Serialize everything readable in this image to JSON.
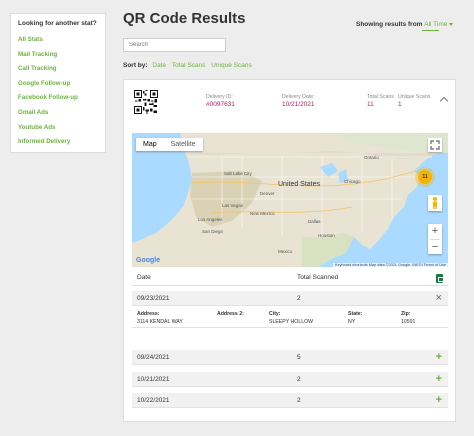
{
  "sidebar": {
    "title": "Looking for another stat?",
    "items": [
      "All Stats",
      "Mail Tracking",
      "Call Tracking",
      "Google Follow-up",
      "Facebook Follow-up",
      "Gmail Ads",
      "Youtube Ads",
      "Informed Delivery"
    ]
  },
  "header": {
    "title": "QR Code Results",
    "showing_label": "Showing results from",
    "range_value": "All Time"
  },
  "search": {
    "placeholder": "Search"
  },
  "sort": {
    "label": "Sort by:",
    "options": [
      "Date",
      "Total Scans",
      "Unique Scans"
    ]
  },
  "card": {
    "delivery_id_label": "Delivery ID:",
    "delivery_id": "#0097631",
    "delivery_date_label": "Delivery Date:",
    "delivery_date": "10/21/2021",
    "total_scans_label": "Total Scans",
    "total_scans": "11",
    "unique_scans_label": "Unique Scans",
    "unique_scans": "1"
  },
  "map": {
    "tabs": [
      "Map",
      "Satellite"
    ],
    "country_label": "United States",
    "marker_count": "11",
    "google": "Google",
    "attribution": "Keyboard shortcuts   Map data ©2021 Google, INEGI   Terms of Use",
    "place_labels": [
      "Salt Lake City",
      "Las Vegas",
      "Los Angeles",
      "San Diego",
      "Denver",
      "Dallas",
      "Houston",
      "Chicago",
      "New Mexico",
      "Mexico",
      "Ontario"
    ]
  },
  "table": {
    "headers": {
      "date": "Date",
      "total": "Total Scanned"
    },
    "rows": [
      {
        "date": "09/23/2021",
        "total": "2",
        "expanded": true
      },
      {
        "date": "09/24/2021",
        "total": "5",
        "expanded": false
      },
      {
        "date": "10/21/2021",
        "total": "2",
        "expanded": false
      },
      {
        "date": "10/22/2021",
        "total": "2",
        "expanded": false
      }
    ],
    "detail": {
      "address_label": "Address:",
      "address": "3114 KENDAL WAY",
      "address2_label": "Address 2:",
      "address2": "",
      "city_label": "City:",
      "city": "SLEEPY HOLLOW",
      "state_label": "State:",
      "state": "NY",
      "zip_label": "Zip:",
      "zip": "10591"
    },
    "actions": {
      "close": "×",
      "expand": "+"
    }
  },
  "colors": {
    "accent": "#6cb33f",
    "delivery": "#c2185b",
    "marker": "#f4b400"
  }
}
